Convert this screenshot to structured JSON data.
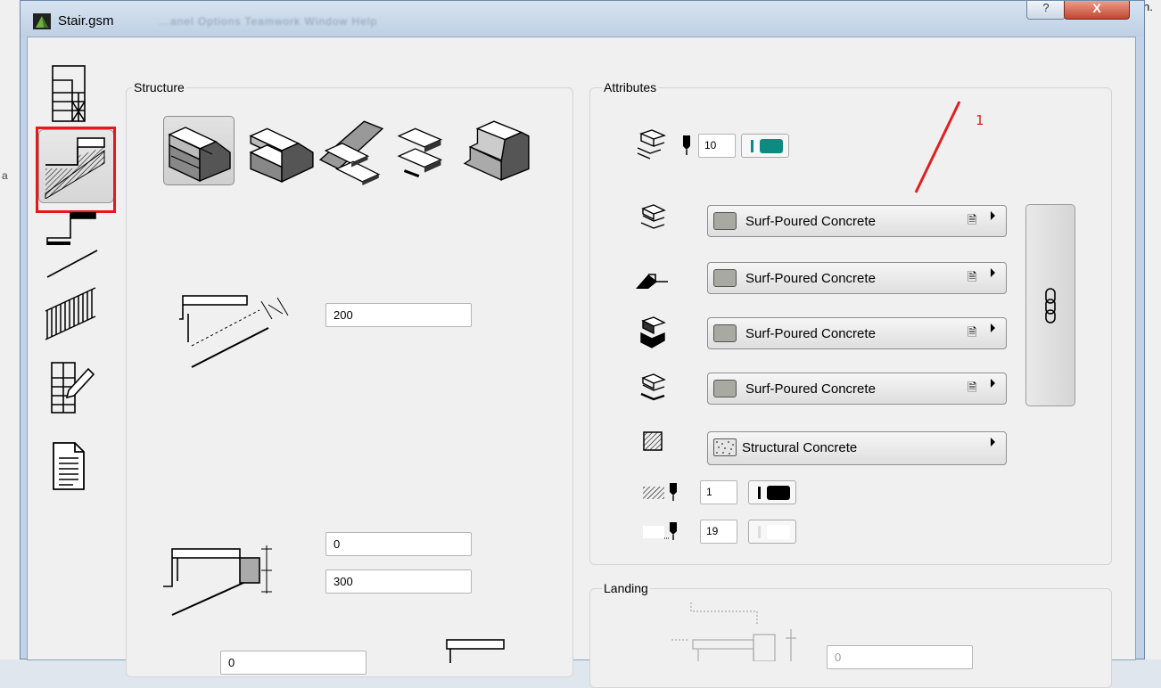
{
  "window": {
    "title": "Stair.gsm",
    "ghost_menu": "...anel    Options    Teamwork    Window    Help",
    "help_label": "?",
    "close_label": "X"
  },
  "background": {
    "left_bits": [
      "a"
    ],
    "right_bits": [
      "n."
    ]
  },
  "nav": {
    "items": [
      {
        "name": "stair-plan-icon",
        "selected": false
      },
      {
        "name": "stair-structure-icon",
        "selected": true
      },
      {
        "name": "stair-steps-icon",
        "selected": false
      },
      {
        "name": "stair-railing-icon",
        "selected": false
      },
      {
        "name": "stair-edit-icon",
        "selected": false
      },
      {
        "name": "document-icon",
        "selected": false
      }
    ]
  },
  "structure": {
    "label": "Structure",
    "stair_types": [
      "solid-stair",
      "cantilever-stair",
      "stringer-stair",
      "floating-stair",
      "monolithic-stair"
    ],
    "selected_type": 0,
    "thickness_value": "200",
    "offset_value": "0",
    "depth_value": "300",
    "partial_value": "0"
  },
  "attributes": {
    "label": "Attributes",
    "contour_pen": "10",
    "materials": [
      "Surf-Poured Concrete",
      "Surf-Poured Concrete",
      "Surf-Poured Concrete",
      "Surf-Poured Concrete"
    ],
    "fill": "Structural Concrete",
    "fill_pen": "1",
    "bg_pen": "19"
  },
  "landing": {
    "label": "Landing",
    "value": "0"
  },
  "annotation": {
    "label": "1",
    "color": "#e0201f"
  },
  "colors": {
    "accent_teal": "#0e8b80",
    "highlight_red": "#e8161d"
  }
}
